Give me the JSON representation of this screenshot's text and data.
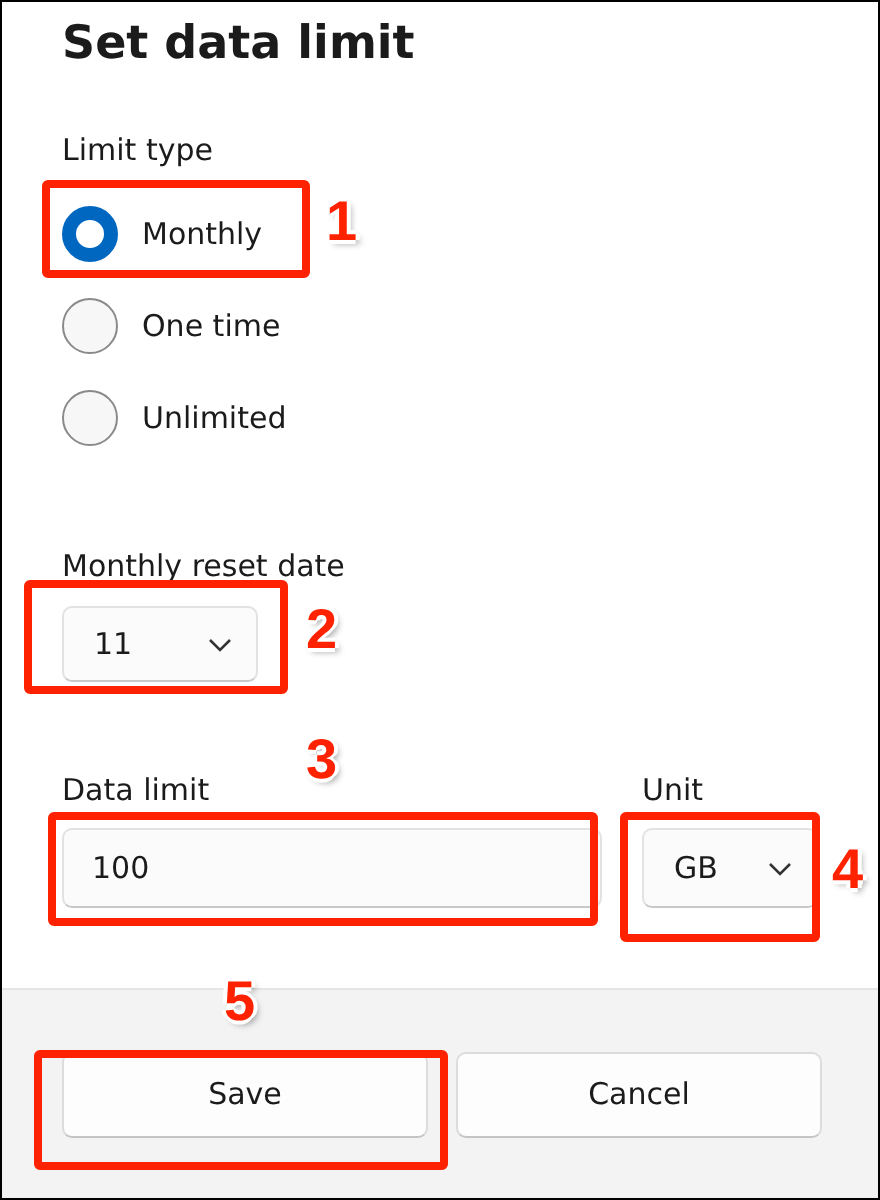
{
  "title": "Set data limit",
  "limit_type": {
    "label": "Limit type",
    "options": [
      {
        "label": "Monthly",
        "selected": true
      },
      {
        "label": "One time",
        "selected": false
      },
      {
        "label": "Unlimited",
        "selected": false
      }
    ]
  },
  "reset_date": {
    "label": "Monthly reset date",
    "value": "11"
  },
  "data_limit": {
    "label": "Data limit",
    "value": "100"
  },
  "unit": {
    "label": "Unit",
    "value": "GB"
  },
  "buttons": [
    {
      "label": "Save"
    },
    {
      "label": "Cancel"
    }
  ],
  "annotations": [
    {
      "number": "1"
    },
    {
      "number": "2"
    },
    {
      "number": "3"
    },
    {
      "number": "4"
    },
    {
      "number": "5"
    }
  ]
}
